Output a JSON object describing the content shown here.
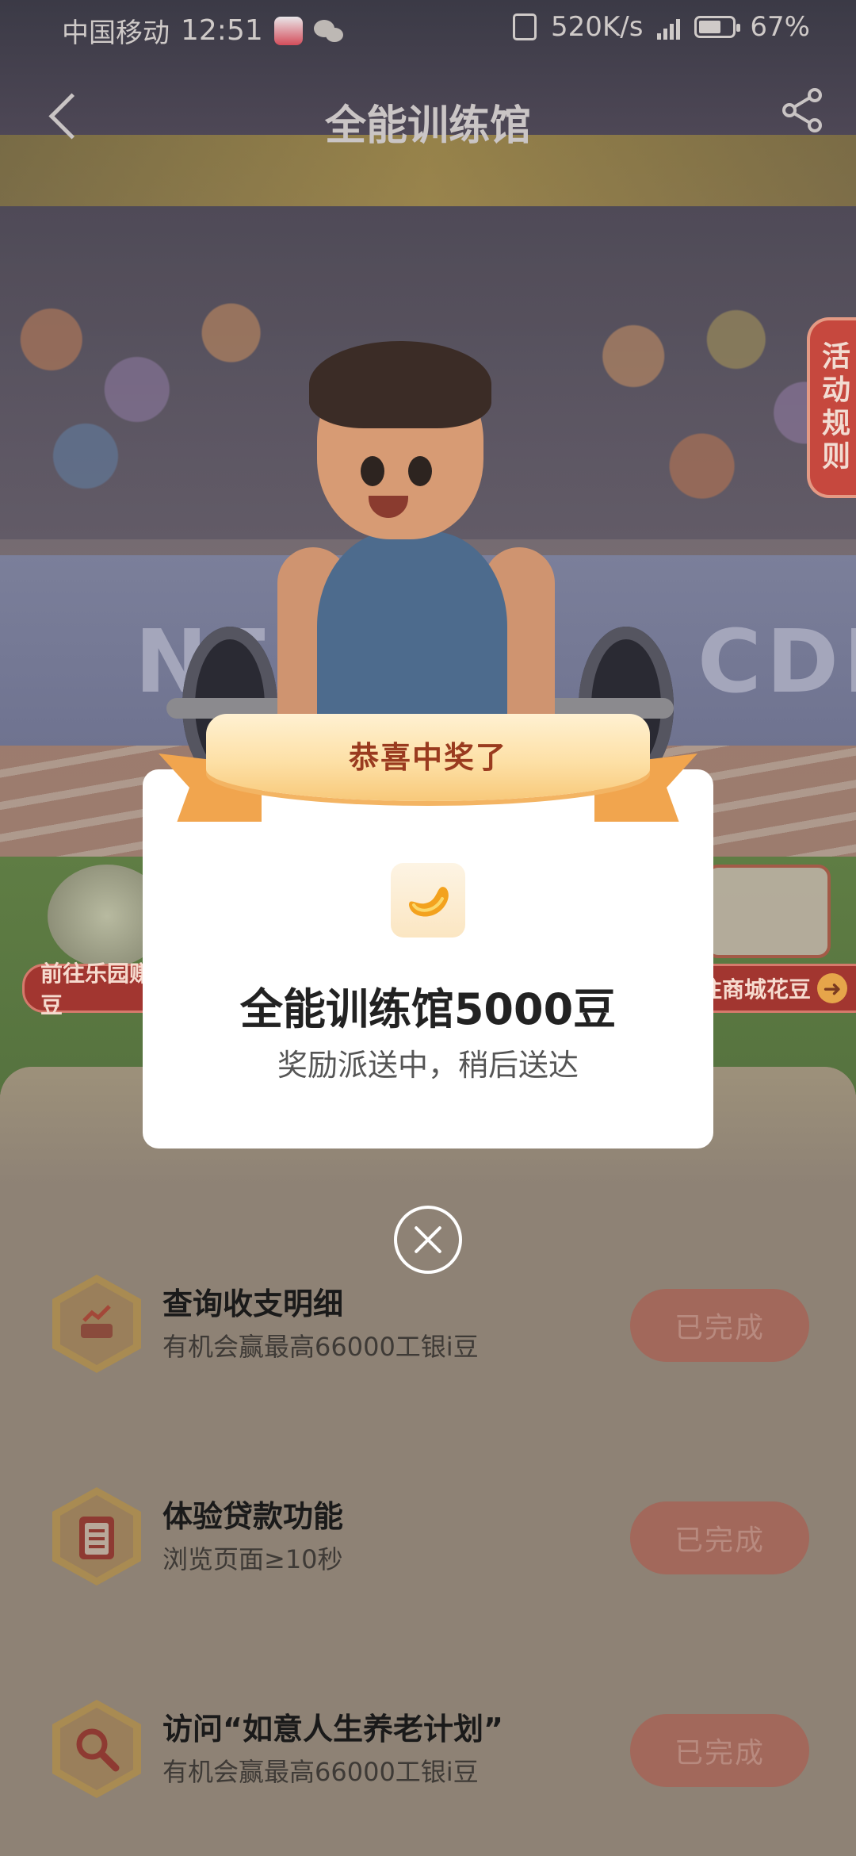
{
  "status_bar": {
    "carrier": "中国移动",
    "time": "12:51",
    "net_speed": "520K/s",
    "network": "4G",
    "battery": "67%",
    "battery_level": 0.67
  },
  "nav": {
    "title": "全能训练馆",
    "back_icon": "back-chevron-icon",
    "share_icon": "share-icon"
  },
  "rules_tab": {
    "label": "活动规则"
  },
  "side_links": {
    "left": "前往乐园赚豆",
    "right": "往商城花豆"
  },
  "tasks": [
    {
      "title": "查询收支明细",
      "subtitle": "有机会赢最高66000工银i豆",
      "button": "已完成",
      "icon": "bill-chart-icon"
    },
    {
      "title": "体验贷款功能",
      "subtitle": "浏览页面≥10秒",
      "button": "已完成",
      "icon": "clipboard-icon"
    },
    {
      "title": "访问“如意人生养老计划”",
      "subtitle": "有机会赢最高66000工银i豆",
      "button": "已完成",
      "icon": "magnifier-icon"
    }
  ],
  "modal": {
    "ribbon": "恭喜中奖了",
    "prize_title": "全能训练馆5000豆",
    "prize_subtitle": "奖励派送中，稍后送达",
    "prize_icon": "bean-icon",
    "close_icon": "close-circle-icon"
  }
}
